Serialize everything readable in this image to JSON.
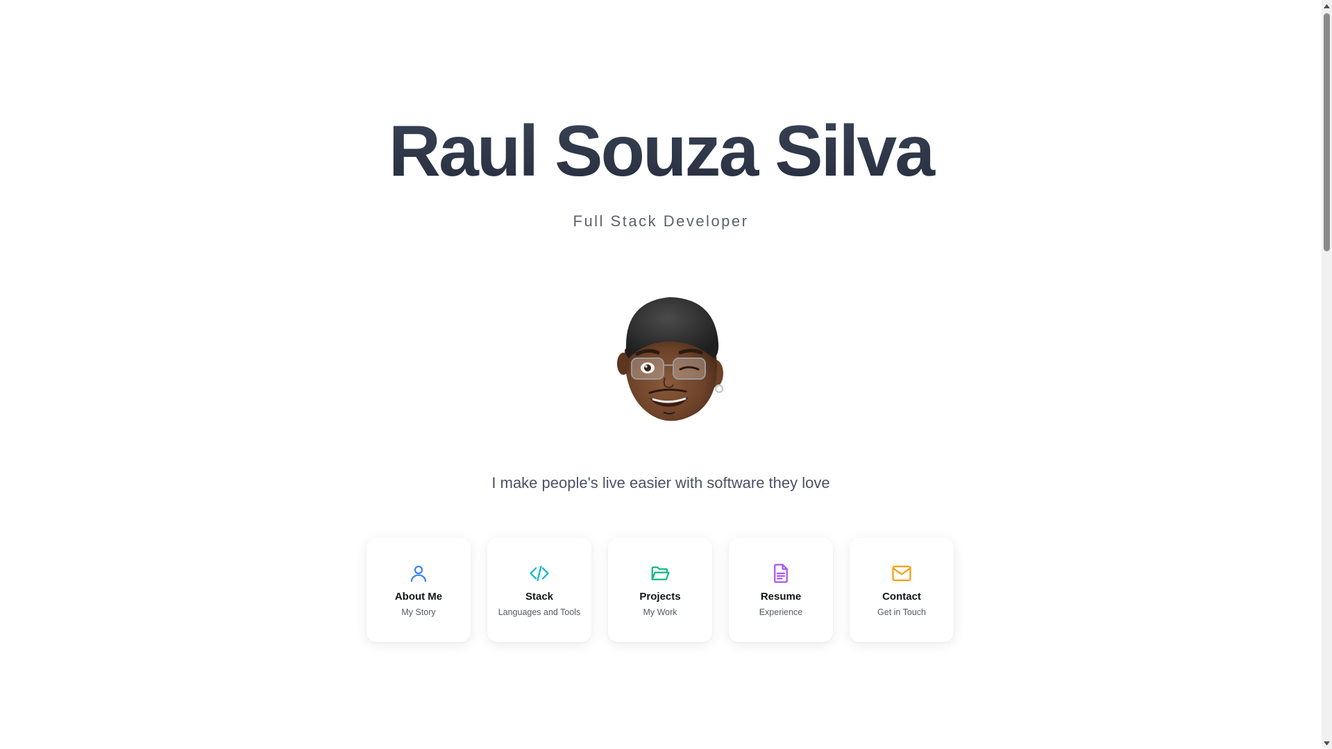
{
  "hero": {
    "name": "Raul Souza Silva",
    "role": "Full Stack Developer",
    "tagline": "I make people's live easier with software they love"
  },
  "avatar": {
    "icon": "memoji-avatar"
  },
  "nav_cards": [
    {
      "label": "About Me",
      "sub": "My Story",
      "icon": "user-icon",
      "color": "#3b82f6"
    },
    {
      "label": "Stack",
      "sub": "Languages and Tools",
      "icon": "code-icon",
      "color": "#06b6d4"
    },
    {
      "label": "Projects",
      "sub": "My Work",
      "icon": "folder-open-icon",
      "color": "#10b981"
    },
    {
      "label": "Resume",
      "sub": "Experience",
      "icon": "document-icon",
      "color": "#a855f7"
    },
    {
      "label": "Contact",
      "sub": "Get in Touch",
      "icon": "mail-icon",
      "color": "#f59e0b"
    }
  ],
  "colors": {
    "title_gradient_top": "#3a4457",
    "title_gradient_bottom": "#262d3d",
    "subtitle": "#5b6270",
    "tagline": "#4a5263"
  }
}
